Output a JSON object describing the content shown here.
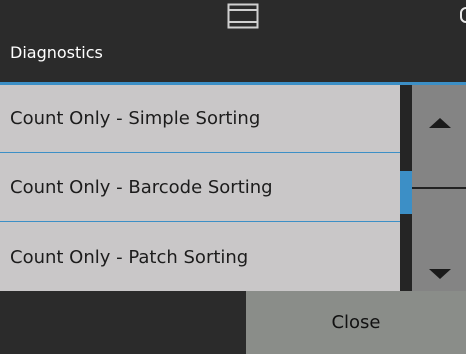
{
  "header": {
    "title": "Diagnostics",
    "icon": "window-icon"
  },
  "list": {
    "items": [
      {
        "label": "Count Only - Simple Sorting"
      },
      {
        "label": "Count Only - Barcode Sorting"
      },
      {
        "label": "Count Only - Patch Sorting"
      }
    ]
  },
  "scrollbar": {
    "up_icon": "scroll-up-arrow-icon",
    "down_icon": "scroll-down-arrow-icon"
  },
  "footer": {
    "close_label": "Close"
  },
  "colors": {
    "background": "#2b2b2b",
    "accent": "#3c8fc6",
    "list_background": "#c9c7c8",
    "scroll_button": "#848484",
    "close_button": "#8a8d89"
  }
}
